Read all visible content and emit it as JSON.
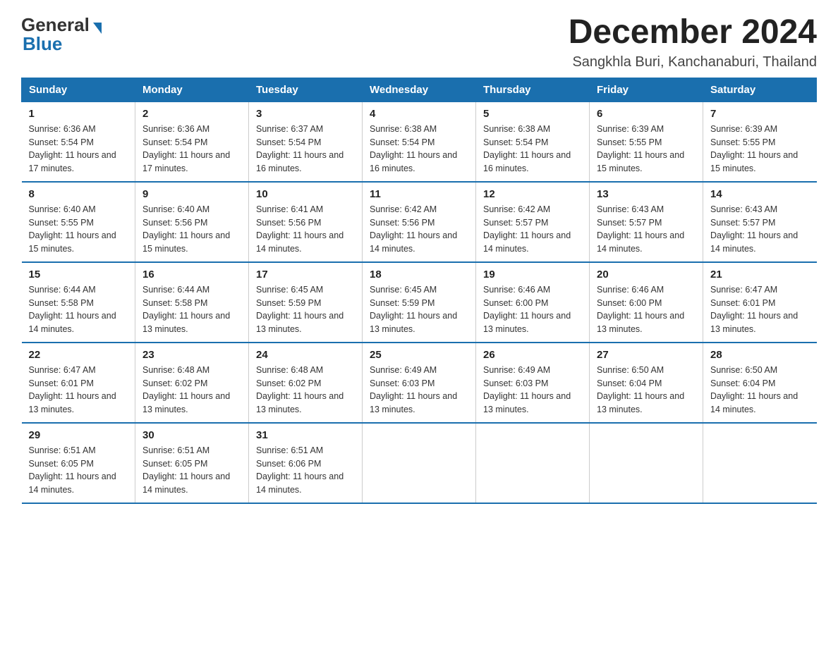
{
  "header": {
    "logo_general": "General",
    "logo_blue": "Blue",
    "main_title": "December 2024",
    "subtitle": "Sangkhla Buri, Kanchanaburi, Thailand"
  },
  "days_of_week": [
    "Sunday",
    "Monday",
    "Tuesday",
    "Wednesday",
    "Thursday",
    "Friday",
    "Saturday"
  ],
  "weeks": [
    [
      {
        "day": "1",
        "sunrise": "6:36 AM",
        "sunset": "5:54 PM",
        "daylight": "11 hours and 17 minutes."
      },
      {
        "day": "2",
        "sunrise": "6:36 AM",
        "sunset": "5:54 PM",
        "daylight": "11 hours and 17 minutes."
      },
      {
        "day": "3",
        "sunrise": "6:37 AM",
        "sunset": "5:54 PM",
        "daylight": "11 hours and 16 minutes."
      },
      {
        "day": "4",
        "sunrise": "6:38 AM",
        "sunset": "5:54 PM",
        "daylight": "11 hours and 16 minutes."
      },
      {
        "day": "5",
        "sunrise": "6:38 AM",
        "sunset": "5:54 PM",
        "daylight": "11 hours and 16 minutes."
      },
      {
        "day": "6",
        "sunrise": "6:39 AM",
        "sunset": "5:55 PM",
        "daylight": "11 hours and 15 minutes."
      },
      {
        "day": "7",
        "sunrise": "6:39 AM",
        "sunset": "5:55 PM",
        "daylight": "11 hours and 15 minutes."
      }
    ],
    [
      {
        "day": "8",
        "sunrise": "6:40 AM",
        "sunset": "5:55 PM",
        "daylight": "11 hours and 15 minutes."
      },
      {
        "day": "9",
        "sunrise": "6:40 AM",
        "sunset": "5:56 PM",
        "daylight": "11 hours and 15 minutes."
      },
      {
        "day": "10",
        "sunrise": "6:41 AM",
        "sunset": "5:56 PM",
        "daylight": "11 hours and 14 minutes."
      },
      {
        "day": "11",
        "sunrise": "6:42 AM",
        "sunset": "5:56 PM",
        "daylight": "11 hours and 14 minutes."
      },
      {
        "day": "12",
        "sunrise": "6:42 AM",
        "sunset": "5:57 PM",
        "daylight": "11 hours and 14 minutes."
      },
      {
        "day": "13",
        "sunrise": "6:43 AM",
        "sunset": "5:57 PM",
        "daylight": "11 hours and 14 minutes."
      },
      {
        "day": "14",
        "sunrise": "6:43 AM",
        "sunset": "5:57 PM",
        "daylight": "11 hours and 14 minutes."
      }
    ],
    [
      {
        "day": "15",
        "sunrise": "6:44 AM",
        "sunset": "5:58 PM",
        "daylight": "11 hours and 14 minutes."
      },
      {
        "day": "16",
        "sunrise": "6:44 AM",
        "sunset": "5:58 PM",
        "daylight": "11 hours and 13 minutes."
      },
      {
        "day": "17",
        "sunrise": "6:45 AM",
        "sunset": "5:59 PM",
        "daylight": "11 hours and 13 minutes."
      },
      {
        "day": "18",
        "sunrise": "6:45 AM",
        "sunset": "5:59 PM",
        "daylight": "11 hours and 13 minutes."
      },
      {
        "day": "19",
        "sunrise": "6:46 AM",
        "sunset": "6:00 PM",
        "daylight": "11 hours and 13 minutes."
      },
      {
        "day": "20",
        "sunrise": "6:46 AM",
        "sunset": "6:00 PM",
        "daylight": "11 hours and 13 minutes."
      },
      {
        "day": "21",
        "sunrise": "6:47 AM",
        "sunset": "6:01 PM",
        "daylight": "11 hours and 13 minutes."
      }
    ],
    [
      {
        "day": "22",
        "sunrise": "6:47 AM",
        "sunset": "6:01 PM",
        "daylight": "11 hours and 13 minutes."
      },
      {
        "day": "23",
        "sunrise": "6:48 AM",
        "sunset": "6:02 PM",
        "daylight": "11 hours and 13 minutes."
      },
      {
        "day": "24",
        "sunrise": "6:48 AM",
        "sunset": "6:02 PM",
        "daylight": "11 hours and 13 minutes."
      },
      {
        "day": "25",
        "sunrise": "6:49 AM",
        "sunset": "6:03 PM",
        "daylight": "11 hours and 13 minutes."
      },
      {
        "day": "26",
        "sunrise": "6:49 AM",
        "sunset": "6:03 PM",
        "daylight": "11 hours and 13 minutes."
      },
      {
        "day": "27",
        "sunrise": "6:50 AM",
        "sunset": "6:04 PM",
        "daylight": "11 hours and 13 minutes."
      },
      {
        "day": "28",
        "sunrise": "6:50 AM",
        "sunset": "6:04 PM",
        "daylight": "11 hours and 14 minutes."
      }
    ],
    [
      {
        "day": "29",
        "sunrise": "6:51 AM",
        "sunset": "6:05 PM",
        "daylight": "11 hours and 14 minutes."
      },
      {
        "day": "30",
        "sunrise": "6:51 AM",
        "sunset": "6:05 PM",
        "daylight": "11 hours and 14 minutes."
      },
      {
        "day": "31",
        "sunrise": "6:51 AM",
        "sunset": "6:06 PM",
        "daylight": "11 hours and 14 minutes."
      },
      null,
      null,
      null,
      null
    ]
  ]
}
